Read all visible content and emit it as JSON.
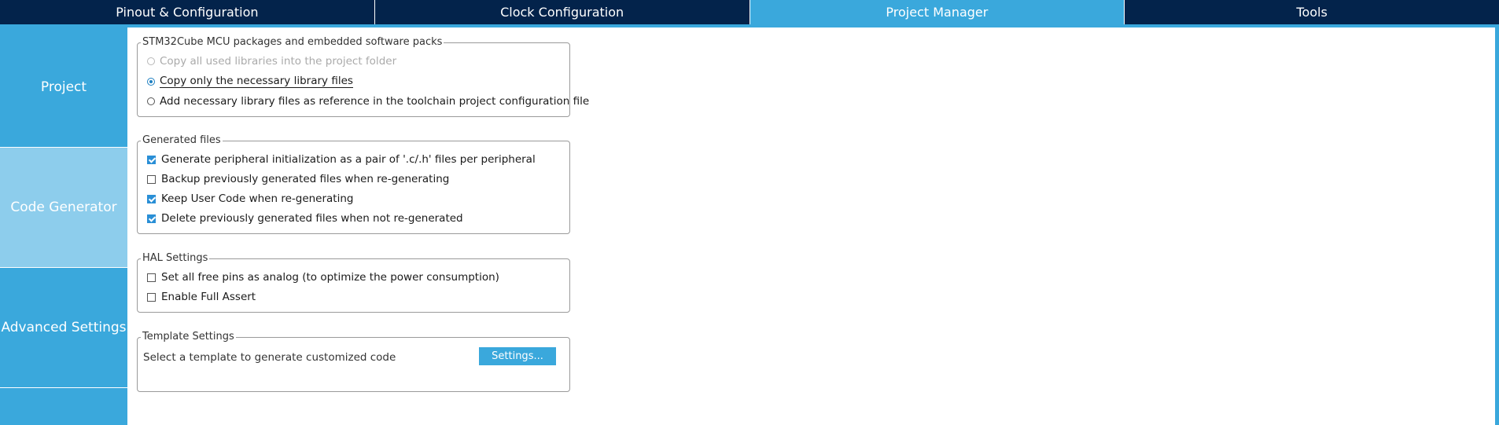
{
  "tabs": [
    {
      "label": "Pinout & Configuration"
    },
    {
      "label": "Clock Configuration"
    },
    {
      "label": "Project Manager"
    },
    {
      "label": "Tools"
    }
  ],
  "active_tab": "Project Manager",
  "sidebar": {
    "items": [
      {
        "label": "Project"
      },
      {
        "label": "Code Generator"
      },
      {
        "label": "Advanced Settings"
      }
    ],
    "active_item": "Code Generator"
  },
  "packages_group": {
    "legend": "STM32Cube MCU packages and embedded software packs",
    "selected": "Copy only the necessary library files",
    "options": [
      {
        "label": "Copy all used libraries into the project folder",
        "enabled": false
      },
      {
        "label": "Copy only the necessary library files",
        "enabled": true
      },
      {
        "label": "Add necessary library files as reference in the toolchain project configuration file",
        "enabled": true
      }
    ]
  },
  "generated_files": {
    "legend": "Generated files",
    "options": [
      {
        "label": "Generate peripheral initialization as a pair of '.c/.h' files per peripheral",
        "checked": true
      },
      {
        "label": "Backup previously generated files when re-generating",
        "checked": false
      },
      {
        "label": "Keep User Code when re-generating",
        "checked": true
      },
      {
        "label": "Delete previously generated files when not re-generated",
        "checked": true
      }
    ]
  },
  "hal_settings": {
    "legend": "HAL Settings",
    "options": [
      {
        "label": "Set all free pins as analog (to optimize the power consumption)",
        "checked": false
      },
      {
        "label": "Enable Full Assert",
        "checked": false
      }
    ]
  },
  "template_settings": {
    "legend": "Template Settings",
    "text": "Select a template to generate customized code",
    "button_label": "Settings..."
  },
  "colors": {
    "tab_bar": "#03234b",
    "accent": "#3aa8dc",
    "sidebar_active": "#8dcdec",
    "checkbox_checked": "#2a8fd6"
  }
}
